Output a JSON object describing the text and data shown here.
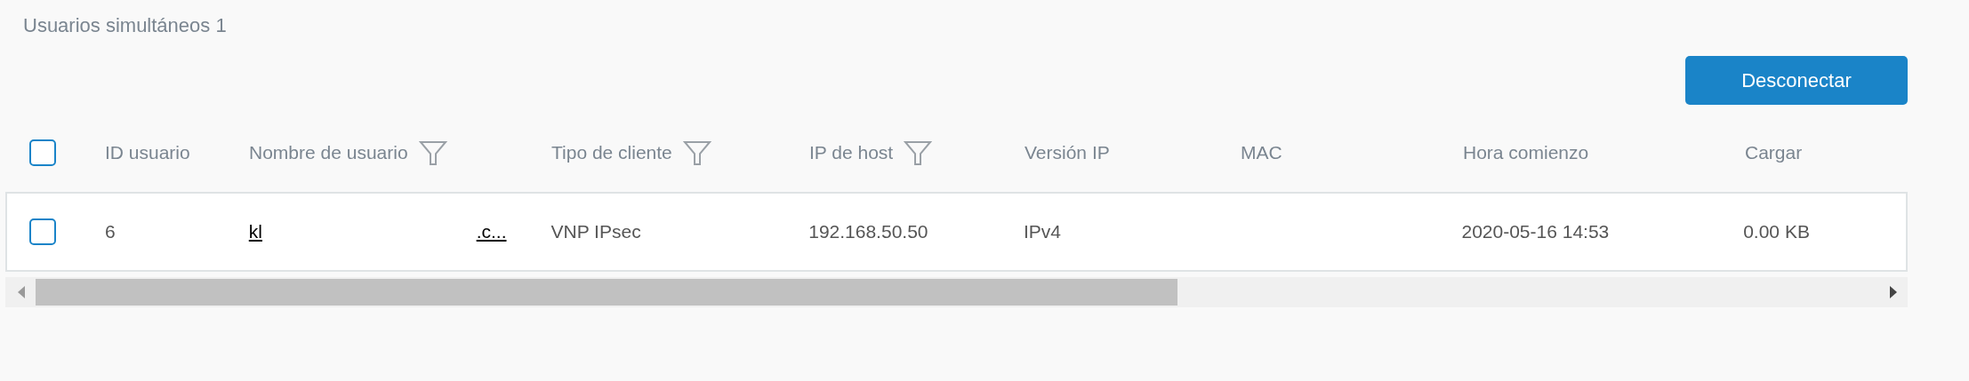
{
  "title": "Usuarios simultáneos 1",
  "disconnect_button": "Desconectar",
  "table": {
    "select_all": {
      "checked": false
    },
    "columns": [
      {
        "label": "ID usuario",
        "filter": false
      },
      {
        "label": "Nombre de usuario",
        "filter": true
      },
      {
        "label": "Tipo de cliente",
        "filter": true
      },
      {
        "label": "IP de host",
        "filter": true
      },
      {
        "label": "Versión IP",
        "filter": false
      },
      {
        "label": "MAC",
        "filter": false
      },
      {
        "label": "Hora comienzo",
        "filter": false
      },
      {
        "label": "Cargar",
        "filter": false
      }
    ],
    "rows": [
      {
        "checked": false,
        "user_id": "6",
        "username": [
          "kl",
          ".c..."
        ],
        "client_type": "VNP IPsec",
        "host_ip": "192.168.50.50",
        "ip_version": "IPv4",
        "start_time": "2020-05-16 14:53",
        "upload": "0.00 KB"
      }
    ]
  }
}
